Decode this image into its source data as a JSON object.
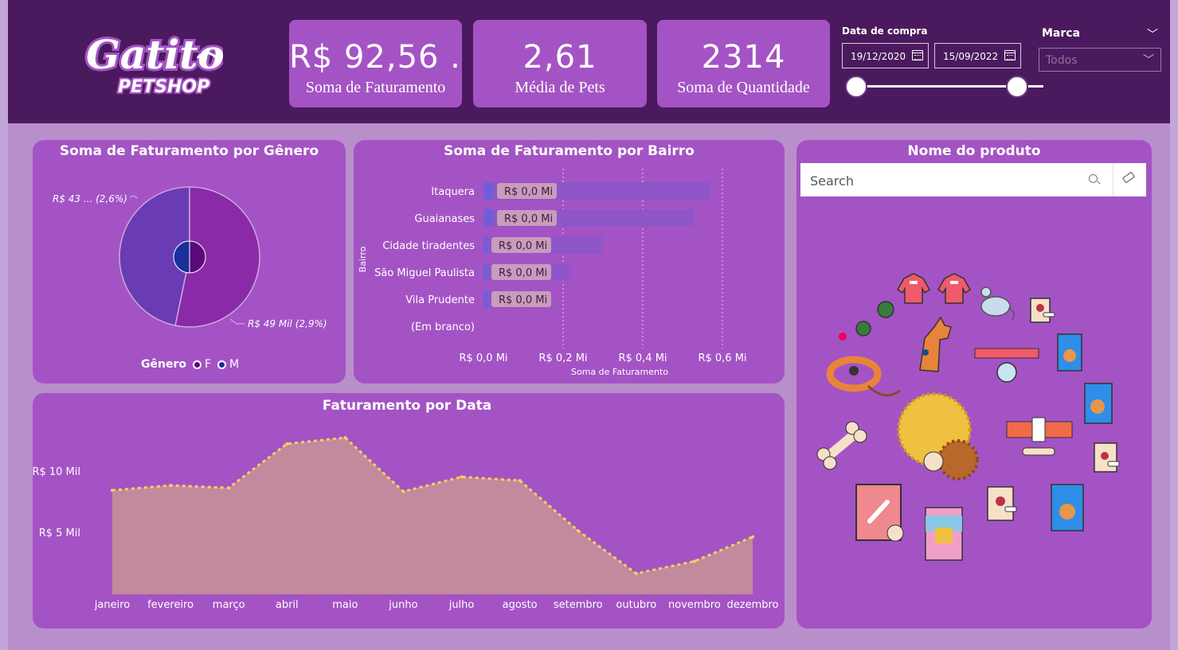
{
  "header": {
    "logo": {
      "line1": "Gatito",
      "line2": "PETSHOP"
    },
    "kpis": [
      {
        "value": "R$ 92,56 ...",
        "label": "Soma de Faturamento"
      },
      {
        "value": "2,61",
        "label": "Média de Pets"
      },
      {
        "value": "2314",
        "label": "Soma de Quantidade"
      }
    ],
    "date_filter": {
      "title": "Data de compra",
      "start": "19/12/2020",
      "end": "15/09/2022",
      "range_fraction": [
        0.0,
        0.86
      ]
    },
    "marca_filter": {
      "title": "Marca",
      "selected": "Todos"
    }
  },
  "gender_card": {
    "title": "Soma de Faturamento por Gênero",
    "label_f": "R$ 43 ... (2,6%)",
    "label_m": "R$ 49 Mil (2,9%)",
    "legend_title": "Gênero",
    "legend_items": [
      {
        "label": "F",
        "color": "#5a0a7a"
      },
      {
        "label": "M",
        "color": "#1a2f9a"
      }
    ]
  },
  "bairro_card": {
    "title": "Soma de Faturamento por Bairro"
  },
  "date_card": {
    "title": "Faturamento por Data"
  },
  "product_card": {
    "title": "Nome do produto",
    "search_placeholder": "Search",
    "icons": [
      "hoodie-icon",
      "hoodie-icon",
      "mouse-toy-icon",
      "pet-food-bag-icon",
      "pet-food-bag-icon",
      "dog-food-bag-icon",
      "dog-food-bag-icon",
      "collar-icon",
      "collar-tag-icon",
      "leash-icon",
      "dog-icon",
      "bone-icon",
      "bone-icon",
      "ball-icon",
      "ball-icon",
      "treat-pack-icon",
      "can-food-icon",
      "bottle-icon",
      "badge-icon"
    ]
  },
  "chart_data": [
    {
      "type": "pie",
      "title": "Soma de Faturamento por Gênero",
      "series": [
        {
          "name": "F",
          "value": 43,
          "label": "R$ 43 ... (2,6%)",
          "color": "#6a3cb4"
        },
        {
          "name": "M",
          "value": 49,
          "label": "R$ 49 Mil (2,9%)",
          "color": "#8a2aa8"
        }
      ]
    },
    {
      "type": "bar",
      "title": "Soma de Faturamento por Bairro",
      "xlabel": "Soma de Faturamento",
      "ylabel": "Bairro",
      "categories": [
        "Itaquera",
        "Guaianases",
        "Cidade tiradentes",
        "São Miguel Paulista",
        "Vila Prudente",
        "(Em branco)"
      ],
      "values": [
        0.0,
        0.0,
        0.0,
        0.0,
        0.0,
        0.0
      ],
      "data_labels": [
        "R$ 0,0 Mi",
        "R$ 0,0 Mi",
        "R$ 0,0 Mi",
        "R$ 0,0 Mi",
        "R$ 0,0 Mi",
        ""
      ],
      "bg_extent": [
        0.57,
        0.53,
        0.3,
        0.22,
        0.16,
        0
      ],
      "xticks": [
        "R$ 0,0 Mi",
        "R$ 0,2 Mi",
        "R$ 0,4 Mi",
        "R$ 0,6 Mi"
      ],
      "xlim": [
        0,
        0.6
      ]
    },
    {
      "type": "area",
      "title": "Faturamento por Data",
      "categories": [
        "janeiro",
        "fevereiro",
        "março",
        "abril",
        "maio",
        "junho",
        "julho",
        "agosto",
        "setembro",
        "outubro",
        "novembro",
        "dezembro"
      ],
      "values": [
        8.5,
        8.9,
        8.7,
        12.3,
        12.8,
        8.4,
        9.6,
        9.3,
        5.2,
        1.7,
        2.7,
        4.7
      ],
      "yticks": [
        "R$ 5 Mil",
        "R$ 10 Mil"
      ],
      "ytick_values": [
        5,
        10
      ],
      "ylim": [
        0,
        14.5
      ]
    }
  ]
}
